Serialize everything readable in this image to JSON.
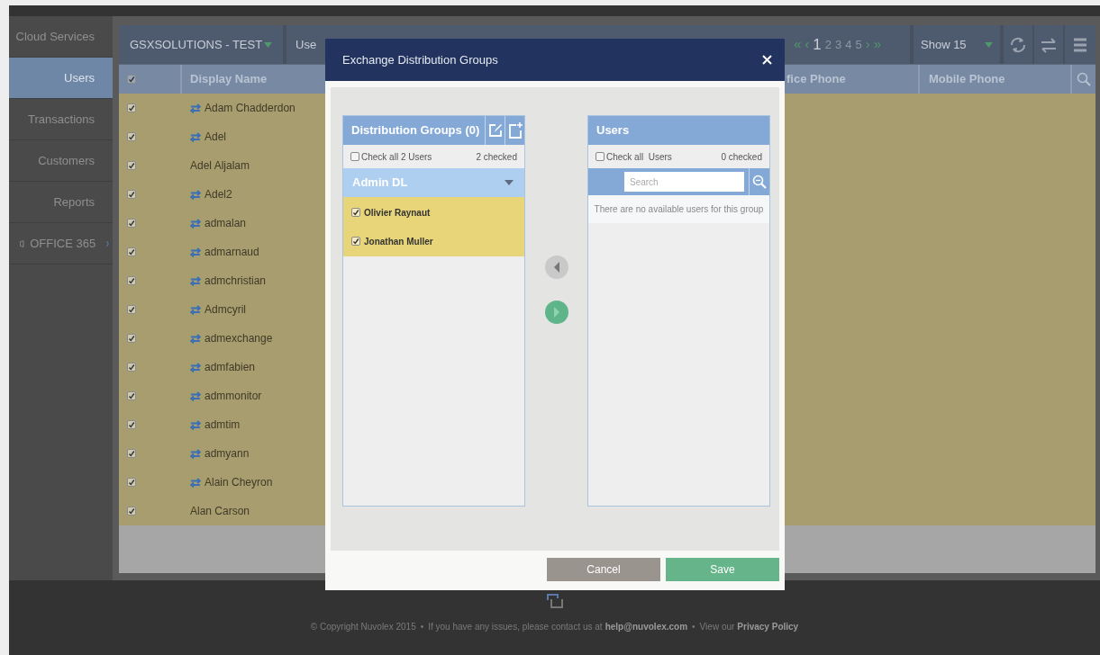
{
  "sidebar": {
    "items": [
      {
        "label": "Cloud Services",
        "selected": false,
        "kind": "link"
      },
      {
        "label": "Users",
        "selected": true,
        "kind": "link"
      },
      {
        "label": "Transactions",
        "selected": false,
        "kind": "link"
      },
      {
        "label": "Customers",
        "selected": false,
        "kind": "link"
      },
      {
        "label": "Reports",
        "selected": false,
        "kind": "link"
      },
      {
        "label": "OFFICE 365",
        "selected": false,
        "kind": "expandable"
      }
    ]
  },
  "toolbar": {
    "tenant": "GSXSOLUTIONS - TEST",
    "tab": "Use",
    "pager": {
      "first": "«",
      "prev": "‹",
      "pages": [
        {
          "label": "1",
          "selected": true
        },
        {
          "label": "2",
          "selected": false
        },
        {
          "label": "3",
          "selected": false
        },
        {
          "label": "4",
          "selected": false
        },
        {
          "label": "5",
          "selected": false
        }
      ],
      "next": "›",
      "last": "»"
    },
    "page_size": "Show 15"
  },
  "table": {
    "select_all_checked": true,
    "columns": [
      "Display Name",
      "fice Phone",
      "Mobile Phone"
    ],
    "rows": [
      {
        "checked": true,
        "synced": true,
        "name": "Adam Chadderdon"
      },
      {
        "checked": true,
        "synced": true,
        "name": "Adel"
      },
      {
        "checked": true,
        "synced": false,
        "name": "Adel Aljalam"
      },
      {
        "checked": true,
        "synced": true,
        "name": "Adel2"
      },
      {
        "checked": true,
        "synced": true,
        "name": "admalan"
      },
      {
        "checked": true,
        "synced": true,
        "name": "admarnaud"
      },
      {
        "checked": true,
        "synced": true,
        "name": "admchristian"
      },
      {
        "checked": true,
        "synced": true,
        "name": "Admcyril"
      },
      {
        "checked": true,
        "synced": true,
        "name": "admexchange"
      },
      {
        "checked": true,
        "synced": true,
        "name": "admfabien"
      },
      {
        "checked": true,
        "synced": true,
        "name": "admmonitor"
      },
      {
        "checked": true,
        "synced": true,
        "name": "admtim"
      },
      {
        "checked": true,
        "synced": true,
        "name": "admyann"
      },
      {
        "checked": true,
        "synced": true,
        "name": "Alain Cheyron"
      },
      {
        "checked": true,
        "synced": false,
        "name": "Alan Carson"
      }
    ]
  },
  "dialog": {
    "title": "Exchange Distribution Groups",
    "groups_panel": {
      "title": "Distribution Groups (0)",
      "check_all": {
        "label": "Check all 2 Users",
        "checked": false
      },
      "count": "2 checked",
      "group": {
        "name": "Admin DL",
        "expanded": true,
        "members": [
          {
            "name": "Olivier Raynaut",
            "checked": true
          },
          {
            "name": "Jonathan Muller",
            "checked": true
          }
        ]
      }
    },
    "move_left": {
      "disabled": true
    },
    "move_right": {
      "disabled": false
    },
    "users_panel": {
      "title": "Users",
      "check_all": {
        "label": "Check all  Users",
        "checked": false
      },
      "count": "0 checked",
      "search": {
        "placeholder": "Search"
      },
      "empty_message": "There are no available users for this group"
    },
    "buttons": [
      {
        "label": "Cancel",
        "kind": "secondary"
      },
      {
        "label": "Save",
        "kind": "primary"
      }
    ]
  },
  "footer": {
    "copyright": "© Copyright Nuvolex 2015",
    "separators": [
      "•",
      "•"
    ],
    "contact": "If you have any issues, please contact us at",
    "email": "help@nuvolex.com",
    "privacy_prefix": "View our",
    "privacy_link": "Privacy Policy"
  }
}
